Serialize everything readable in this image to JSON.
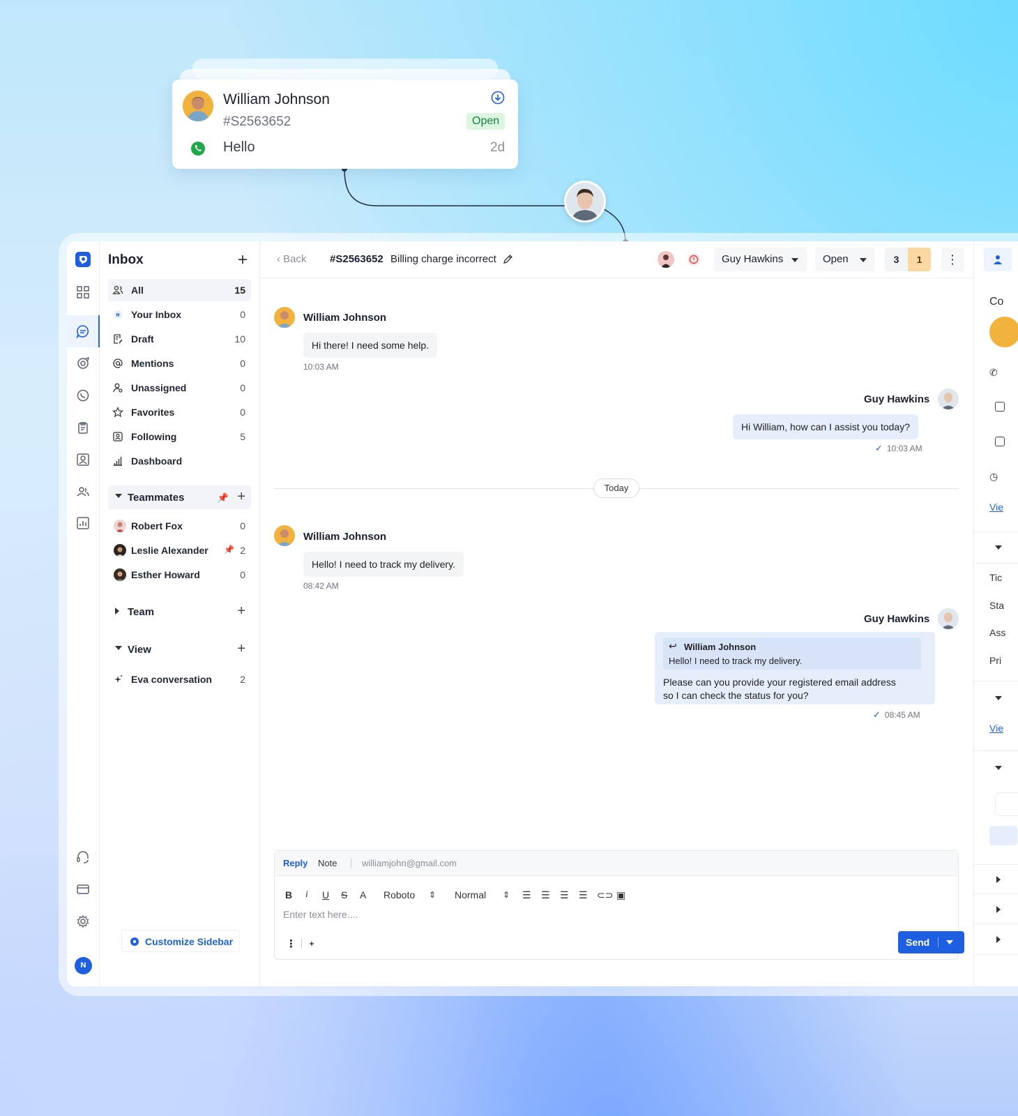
{
  "preview_card": {
    "name": "William Johnson",
    "ticket_id": "#S2563652",
    "status": "Open",
    "last_message": "Hello",
    "age": "2d"
  },
  "sidebar": {
    "title": "Inbox",
    "items": [
      {
        "label": "All",
        "count": "15",
        "icon": "users-icon"
      },
      {
        "label": "Your Inbox",
        "count": "0",
        "icon": "inbox-icon"
      },
      {
        "label": "Draft",
        "count": "10",
        "icon": "draft-icon"
      },
      {
        "label": "Mentions",
        "count": "0",
        "icon": "at-icon"
      },
      {
        "label": "Unassigned",
        "count": "0",
        "icon": "user-icon"
      },
      {
        "label": "Favorites",
        "count": "0",
        "icon": "star-icon"
      },
      {
        "label": "Following",
        "count": "5",
        "icon": "following-icon"
      },
      {
        "label": "Dashboard",
        "count": "",
        "icon": "bar-chart-icon"
      }
    ],
    "teammates_label": "Teammates",
    "teammates": [
      {
        "name": "Robert Fox",
        "count": "0"
      },
      {
        "name": "Leslie Alexander",
        "count": "2"
      },
      {
        "name": "Esther Howard",
        "count": "0"
      }
    ],
    "team_label": "Team",
    "view_label": "View",
    "eva_label": "Eva conversation",
    "eva_count": "2",
    "customize_label": "Customize Sidebar"
  },
  "rail": {
    "avatar_initial": "N"
  },
  "header": {
    "back_label": "Back",
    "ticket_id": "#S2563652",
    "subject": "Billing charge incorrect",
    "assignee": "Guy Hawkins",
    "status": "Open",
    "count_a": "3",
    "count_b": "1",
    "more": "⋮"
  },
  "messages": [
    {
      "sender": "William Johnson",
      "text": "Hi there! I need some help.",
      "time": "10:03 AM"
    },
    {
      "sender": "Guy Hawkins",
      "text": "Hi William, how can I assist you today?",
      "time": "10:03 AM"
    },
    {
      "sender": "William Johnson",
      "text": "Hello! I need to track my delivery.",
      "time": "08:42 AM"
    },
    {
      "sender": "Guy Hawkins",
      "quote_name": "William Johnson",
      "quote_text": "Hello! I need to track my delivery.",
      "text_line1": "Please can you provide your registered email address",
      "text_line2": "so I can check the status for you?",
      "time": "08:45 AM"
    }
  ],
  "day_divider": "Today",
  "composer": {
    "tab_reply": "Reply",
    "tab_note": "Note",
    "to_email": "williamjohn@gmail.com",
    "font": "Roboto",
    "size": "Normal",
    "placeholder": "Enter text here....",
    "send_label": "Send"
  },
  "right_panel": {
    "title": "Co",
    "link1": "Vie",
    "row1": "Tic",
    "row2": "Sta",
    "row3": "Ass",
    "row4": "Pri",
    "link2": "Vie"
  },
  "colors": {
    "accent": "#1d5fe0",
    "open_badge": "#dcf6df",
    "count_highlight": "#fcd9a2"
  }
}
